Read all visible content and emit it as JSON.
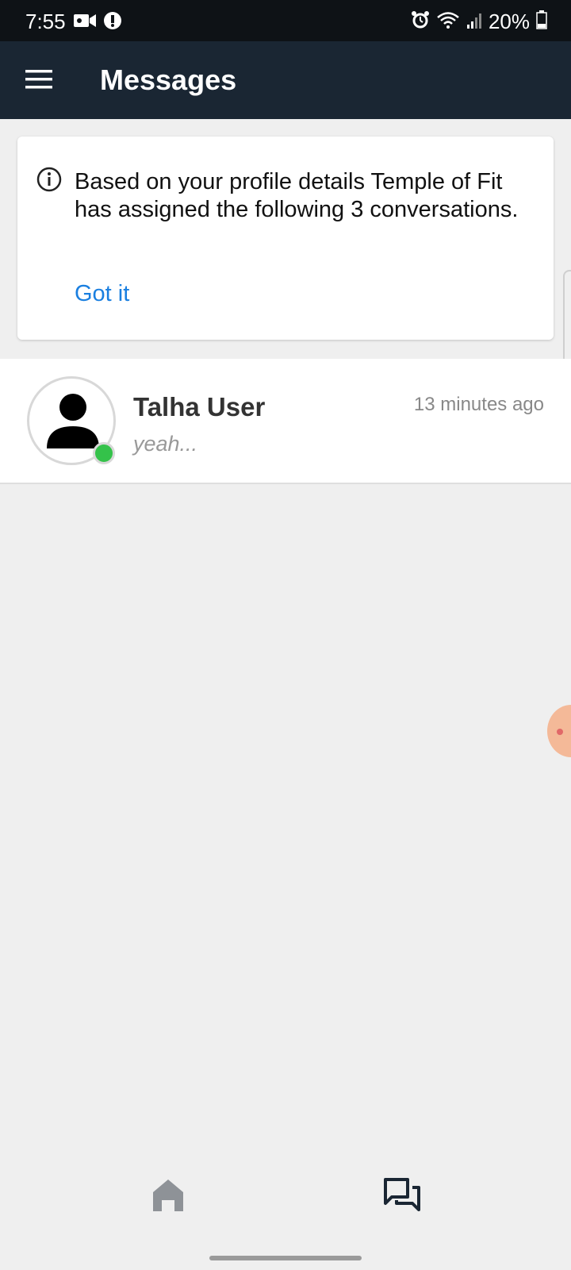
{
  "status_bar": {
    "time": "7:55",
    "battery": "20%",
    "left_icons": [
      "video-camera-icon",
      "status-app-icon"
    ],
    "right_icons": [
      "alarm-icon",
      "wifi-icon",
      "signal-icon",
      "battery-icon"
    ]
  },
  "app_bar": {
    "title": "Messages",
    "menu_icon": "hamburger-menu-icon",
    "background": "#1a2633"
  },
  "info_banner": {
    "icon": "info-icon",
    "text": "Based on your profile details Temple of Fit has assigned the following 3 conversations.",
    "action_label": "Got it",
    "action_color": "#1a7fe0"
  },
  "conversations": [
    {
      "name": "Talha User",
      "preview": "yeah...",
      "time": "13 minutes ago",
      "online": true,
      "online_color": "#34c24a"
    }
  ],
  "bottom_nav": {
    "items": [
      {
        "icon": "home-icon",
        "active": false
      },
      {
        "icon": "messages-icon",
        "active": true
      }
    ]
  }
}
